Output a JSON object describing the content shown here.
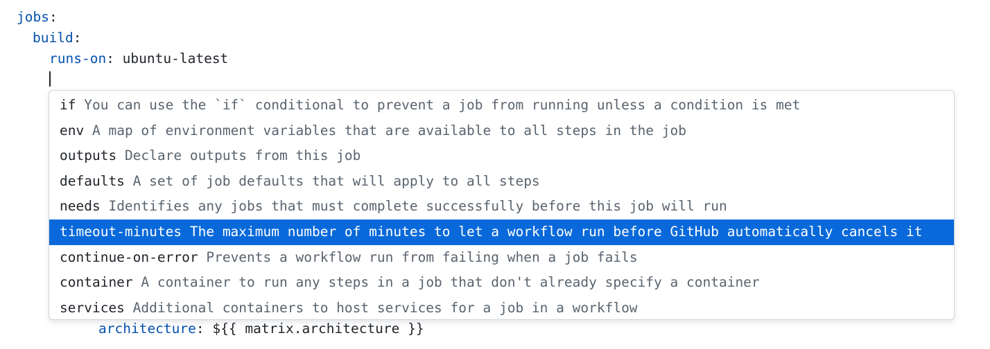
{
  "editor": {
    "lines": [
      {
        "indent": 0,
        "key": "jobs",
        "sep": ":",
        "value": ""
      },
      {
        "indent": 1,
        "key": "build",
        "sep": ":",
        "value": ""
      },
      {
        "indent": 2,
        "key": "runs-on",
        "sep": ":",
        "value": " ubuntu-latest"
      }
    ],
    "trailing_line": {
      "key": "architecture",
      "sep": ":",
      "value": " ${{ matrix.architecture }}"
    }
  },
  "suggestions": {
    "selected_index": 5,
    "items": [
      {
        "name": "if",
        "description": "You can use the `if` conditional to prevent a job from running unless a condition is met"
      },
      {
        "name": "env",
        "description": "A map of environment variables that are available to all steps in the job"
      },
      {
        "name": "outputs",
        "description": "Declare outputs from this job"
      },
      {
        "name": "defaults",
        "description": "A set of job defaults that will apply to all steps"
      },
      {
        "name": "needs",
        "description": "Identifies any jobs that must complete successfully before this job will run"
      },
      {
        "name": "timeout-minutes",
        "description": "The maximum number of minutes to let a workflow run before GitHub automatically cancels it"
      },
      {
        "name": "continue-on-error",
        "description": "Prevents a workflow run from failing when a job fails"
      },
      {
        "name": "container",
        "description": "A container to run any steps in a job that don't already specify a container"
      },
      {
        "name": "services",
        "description": "Additional containers to host services for a job in a workflow"
      }
    ]
  },
  "colors": {
    "key": "#0550ae",
    "text": "#1f2328",
    "description": "#59636e",
    "selection": "#0969da"
  }
}
